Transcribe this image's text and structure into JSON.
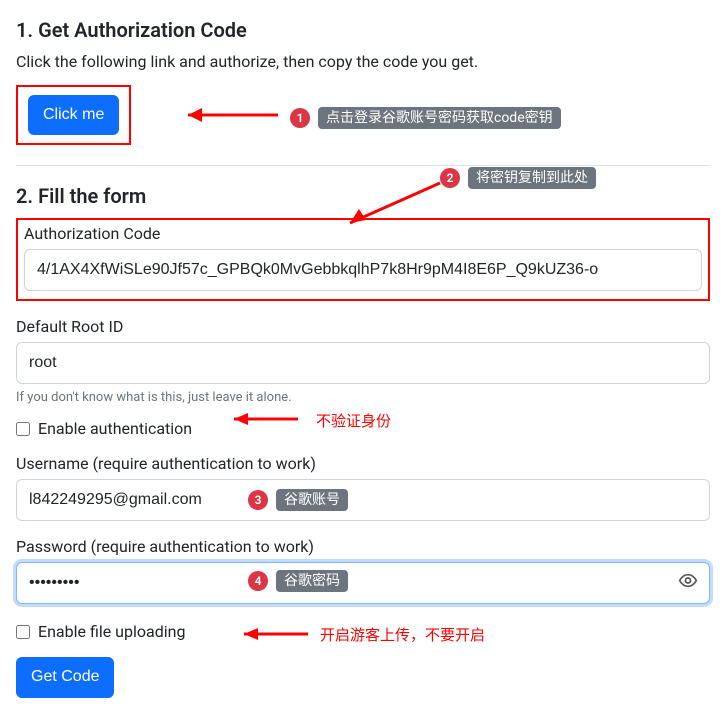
{
  "section1": {
    "title": "1. Get Authorization Code",
    "desc": "Click the following link and authorize, then copy the code you get.",
    "button_label": "Click me"
  },
  "annotations": {
    "a1": {
      "num": "1",
      "text": "点击登录谷歌账号密码获取code密钥"
    },
    "a2": {
      "num": "2",
      "text": "将密钥复制到此处"
    },
    "a3": {
      "num": "3",
      "text": "谷歌账号"
    },
    "a4": {
      "num": "4",
      "text": "谷歌密码"
    }
  },
  "notes": {
    "auth_note": "不验证身份",
    "upload_note": "开启游客上传，不要开启"
  },
  "section2": {
    "title": "2. Fill the form",
    "auth_code_label": "Authorization Code",
    "auth_code_value": "4/1AX4XfWiSLe90Jf57c_GPBQk0MvGebbkqlhP7k8Hr9pM4I8E6P_Q9kUZ36-o",
    "root_label": "Default Root ID",
    "root_value": "root",
    "root_help": "If you don't know what is this, just leave it alone.",
    "enable_auth_label": "Enable authentication",
    "username_label": "Username (require authentication to work)",
    "username_value": "l842249295@gmail.com",
    "password_label": "Password (require authentication to work)",
    "password_value": "•••••••••",
    "enable_upload_label": "Enable file uploading",
    "get_code_label": "Get Code"
  }
}
